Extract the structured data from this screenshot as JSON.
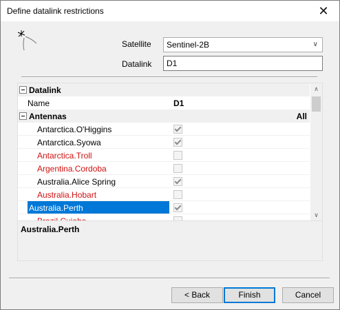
{
  "window": {
    "title": "Define datalink restrictions",
    "close_glyph": "✕"
  },
  "form": {
    "satellite_label": "Satellite",
    "satellite_value": "Sentinel-2B",
    "datalink_label": "Datalink",
    "datalink_value": "D1"
  },
  "grid": {
    "categories": [
      {
        "label": "Datalink"
      },
      {
        "label": "Antennas",
        "right_label": "All"
      }
    ],
    "datalink_rows": [
      {
        "name": "Name",
        "value": "D1"
      }
    ],
    "antennas": [
      {
        "name": "Antarctica.O'Higgins",
        "checked": true,
        "color": "black"
      },
      {
        "name": "Antarctica.Syowa",
        "checked": true,
        "color": "black"
      },
      {
        "name": "Antarctica.Troll",
        "checked": false,
        "color": "red"
      },
      {
        "name": "Argentina.Cordoba",
        "checked": false,
        "color": "red"
      },
      {
        "name": "Australia.Alice Spring",
        "checked": true,
        "color": "black"
      },
      {
        "name": "Australia.Hobart",
        "checked": false,
        "color": "red"
      },
      {
        "name": "Australia.Perth",
        "checked": true,
        "color": "black",
        "selected": true
      },
      {
        "name": "Brazil.Cuiaba",
        "checked": false,
        "color": "red"
      }
    ]
  },
  "description": {
    "title": "Australia.Perth"
  },
  "buttons": {
    "back": "< Back",
    "finish": "Finish",
    "cancel": "Cancel"
  },
  "colors": {
    "selection": "#0078d7",
    "unavailable": "#d01010",
    "category_bg": "#f0f0f0"
  }
}
